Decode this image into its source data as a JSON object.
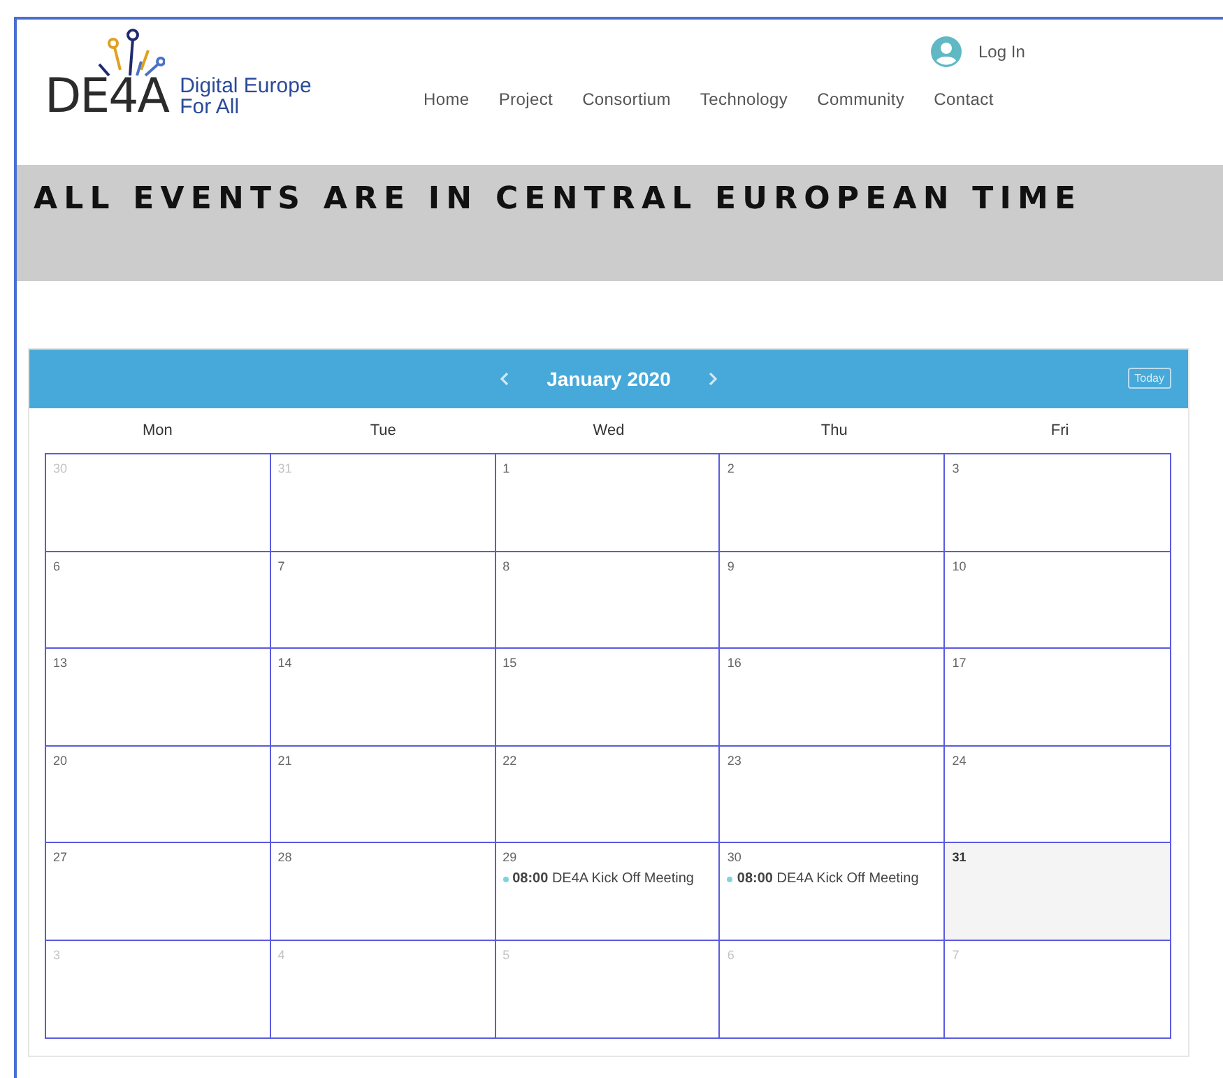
{
  "header": {
    "logo": {
      "mark": "DE4A",
      "tagline_1": "Digital Europe",
      "tagline_2": "For All"
    },
    "login": "Log In",
    "nav": [
      {
        "label": "Home"
      },
      {
        "label": "Project"
      },
      {
        "label": "Consortium"
      },
      {
        "label": "Technology"
      },
      {
        "label": "Community"
      },
      {
        "label": "Contact"
      }
    ]
  },
  "banner": "ALL EVENTS ARE IN CENTRAL EUROPEAN TIME",
  "calendar": {
    "month": "January 2020",
    "today_button": "Today",
    "weekdays": [
      "Mon",
      "Tue",
      "Wed",
      "Thu",
      "Fri"
    ],
    "weeks": [
      [
        {
          "day": "30",
          "other_month": true,
          "today": false
        },
        {
          "day": "31",
          "other_month": true,
          "today": false
        },
        {
          "day": "1",
          "other_month": false,
          "today": false
        },
        {
          "day": "2",
          "other_month": false,
          "today": false
        },
        {
          "day": "3",
          "other_month": false,
          "today": false
        }
      ],
      [
        {
          "day": "6",
          "other_month": false,
          "today": false
        },
        {
          "day": "7",
          "other_month": false,
          "today": false
        },
        {
          "day": "8",
          "other_month": false,
          "today": false
        },
        {
          "day": "9",
          "other_month": false,
          "today": false
        },
        {
          "day": "10",
          "other_month": false,
          "today": false
        }
      ],
      [
        {
          "day": "13",
          "other_month": false,
          "today": false
        },
        {
          "day": "14",
          "other_month": false,
          "today": false
        },
        {
          "day": "15",
          "other_month": false,
          "today": false
        },
        {
          "day": "16",
          "other_month": false,
          "today": false
        },
        {
          "day": "17",
          "other_month": false,
          "today": false
        }
      ],
      [
        {
          "day": "20",
          "other_month": false,
          "today": false
        },
        {
          "day": "21",
          "other_month": false,
          "today": false
        },
        {
          "day": "22",
          "other_month": false,
          "today": false
        },
        {
          "day": "23",
          "other_month": false,
          "today": false
        },
        {
          "day": "24",
          "other_month": false,
          "today": false
        }
      ],
      [
        {
          "day": "27",
          "other_month": false,
          "today": false
        },
        {
          "day": "28",
          "other_month": false,
          "today": false
        },
        {
          "day": "29",
          "other_month": false,
          "today": false,
          "events": [
            {
              "time": "08:00",
              "title": "DE4A Kick Off Meeting",
              "color": "#7fd3e0"
            }
          ]
        },
        {
          "day": "30",
          "other_month": false,
          "today": false,
          "events": [
            {
              "time": "08:00",
              "title": "DE4A Kick Off Meeting",
              "color": "#7fd3e0"
            }
          ]
        },
        {
          "day": "31",
          "other_month": false,
          "today": true
        }
      ],
      [
        {
          "day": "3",
          "other_month": true,
          "today": false
        },
        {
          "day": "4",
          "other_month": true,
          "today": false
        },
        {
          "day": "5",
          "other_month": true,
          "today": false
        },
        {
          "day": "6",
          "other_month": true,
          "today": false
        },
        {
          "day": "7",
          "other_month": true,
          "today": false
        }
      ]
    ]
  }
}
